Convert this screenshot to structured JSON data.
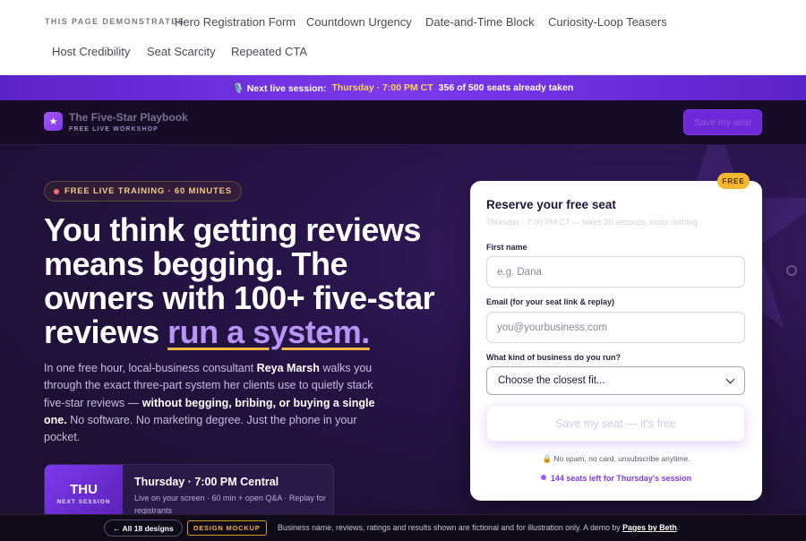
{
  "demo_nav": {
    "label": "THIS PAGE DEMONSTRATES",
    "links": [
      "Hero Registration Form",
      "Countdown Urgency",
      "Date-and-Time Block",
      "Curiosity-Loop Teasers",
      "Host Credibility",
      "Seat Scarcity",
      "Repeated CTA"
    ]
  },
  "promo_bar": {
    "icon": "microphone-icon",
    "prefix": "🎙️ Next live session:",
    "time": "Thursday · 7:00 PM CT",
    "seats": "356 of 500 seats already taken"
  },
  "header": {
    "logo_icon": "star-icon",
    "brand": "The Five-Star Playbook",
    "tagline": "FREE LIVE WORKSHOP",
    "cta": "Save my seat"
  },
  "hero": {
    "badge": "FREE LIVE TRAINING · 60 MINUTES",
    "headline_main": "You think getting reviews means begging. The owners with 100+ five-star reviews",
    "headline_highlight": "run a system.",
    "sub_1": "In one free hour, local-business consultant",
    "sub_host": "Reya Marsh",
    "sub_2": "walks you through the exact three-part system her clients use to quietly stack five-star reviews —",
    "sub_bold": "without begging, bribing, or buying a single one.",
    "sub_3": "No software. No marketing degree. Just the phone in your pocket.",
    "session": {
      "day": "THU",
      "day_sub": "NEXT SESSION",
      "title": "Thursday · 7:00 PM Central",
      "detail": "Live on your screen · 60 min + open Q&A · Replay for registrants"
    }
  },
  "form": {
    "pill": "FREE",
    "title": "Reserve your free seat",
    "subtitle": "Thursday · 7:00 PM CT — takes 20 seconds, costs nothing.",
    "first_name_label": "First name",
    "first_name_placeholder": "e.g. Dana",
    "email_label": "Email (for your seat link & replay)",
    "email_placeholder": "you@yourbusiness.com",
    "business_label": "What kind of business do you run?",
    "business_selected": "Choose the closest fit...",
    "submit": "Save my seat — it's free",
    "privacy": "🔒 No spam, no card, unsubscribe anytime.",
    "seats_left": "144 seats left for Thursday's session"
  },
  "footer": {
    "back": "← All 18 designs",
    "tag": "DESIGN MOCKUP",
    "disclaimer": "Business name, reviews, ratings and results shown are fictional and for illustration only. A demo by",
    "credit": "Pages by Beth",
    "period": "."
  },
  "colors": {
    "accent": "#7c3aed",
    "highlight": "#b794f6",
    "gold": "#f5b72f",
    "hero_bg": "#1d1033"
  }
}
